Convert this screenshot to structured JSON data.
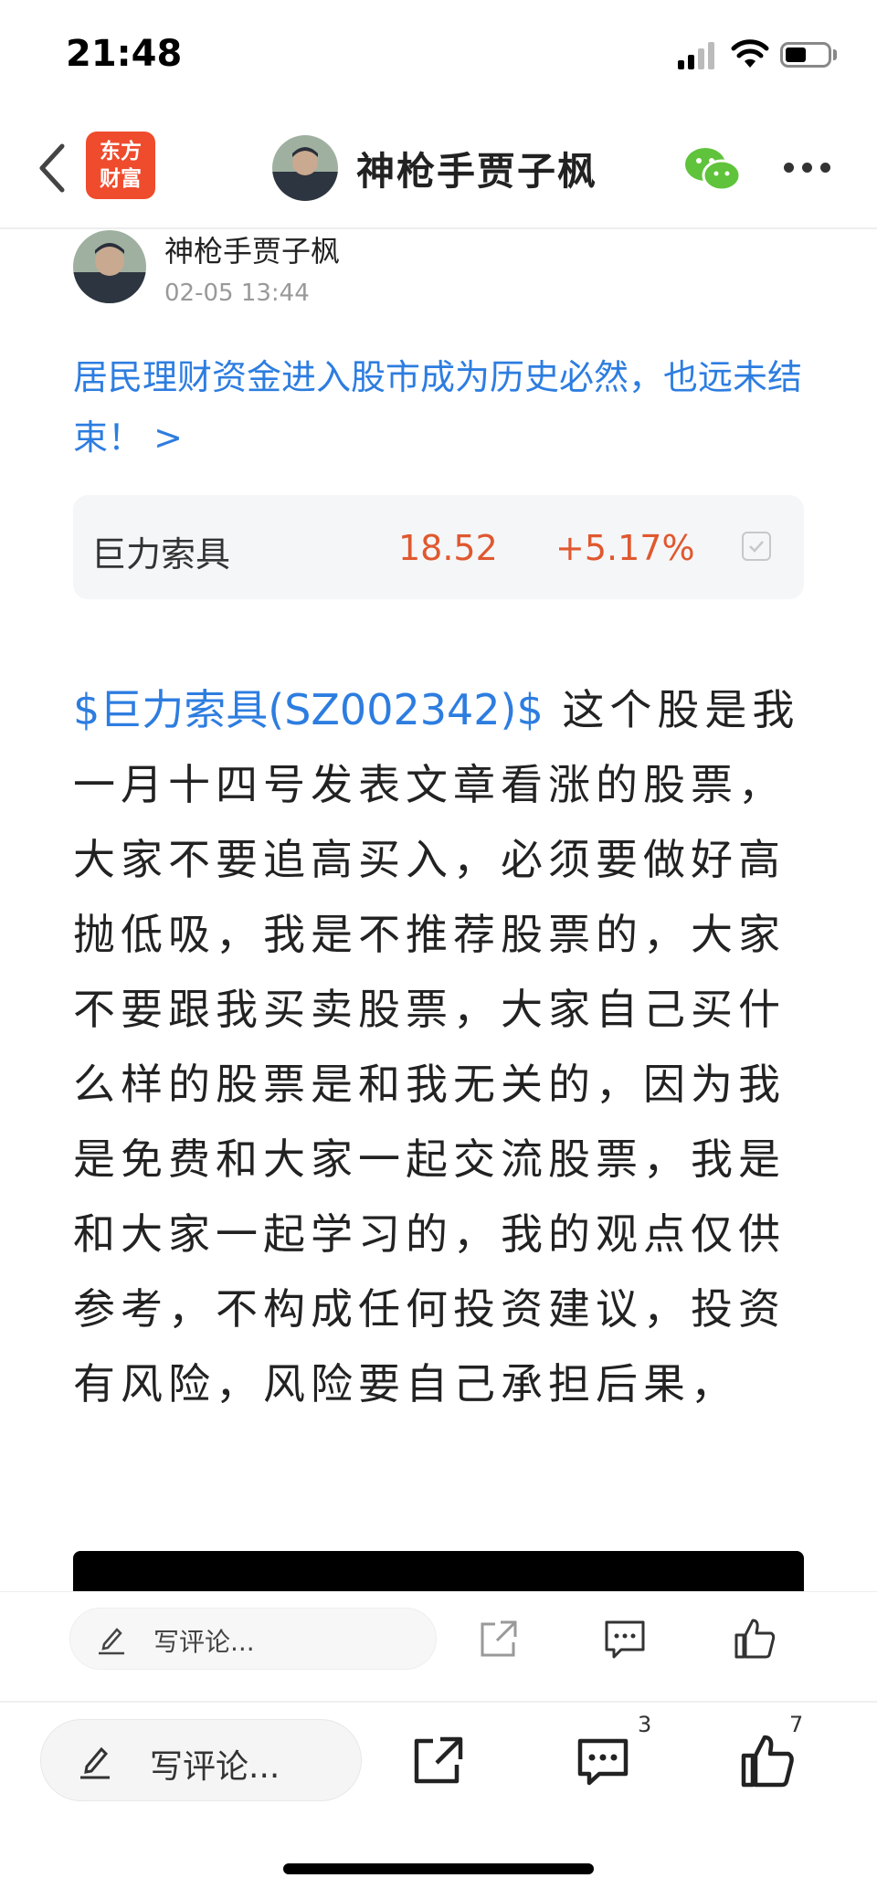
{
  "status_bar": {
    "time": "21:48"
  },
  "header": {
    "logo_line1": "东方",
    "logo_line2": "财富",
    "title": "神枪手贾子枫",
    "logo_color": "#ef4b2d"
  },
  "post": {
    "author": "神枪手贾子枫",
    "time": "02-05 13:44",
    "title_link": "居民理财资金进入股市成为历史必然，也远未结束！ >",
    "stock": {
      "name": "巨力索具",
      "price": "18.52",
      "change": "+5.17%"
    },
    "tag": "$巨力索具(SZ002342)$",
    "body": " 这个股是我一月十四号发表文章看涨的股票，大家不要追高买入，必须要做好高抛低吸，我是不推荐股票的，大家不要跟我买卖股票，大家自己买什么样的股票是和我无关的，因为我是免费和大家一起交流股票，我是和大家一起学习的，我的观点仅供参考，不构成任何投资建议，投资有风险，风险要自己承担后果，"
  },
  "inner_bar": {
    "placeholder": "写评论..."
  },
  "bottom_bar": {
    "placeholder": "写评论...",
    "comment_count": "3",
    "like_count": "7"
  },
  "colors": {
    "link": "#2d7de0",
    "price_up": "#e0582f",
    "wechat": "#5fc33b"
  },
  "icons": [
    "back-icon",
    "wechat-icon",
    "more-icon",
    "pencil-icon",
    "share-icon",
    "comment-icon",
    "like-icon"
  ]
}
